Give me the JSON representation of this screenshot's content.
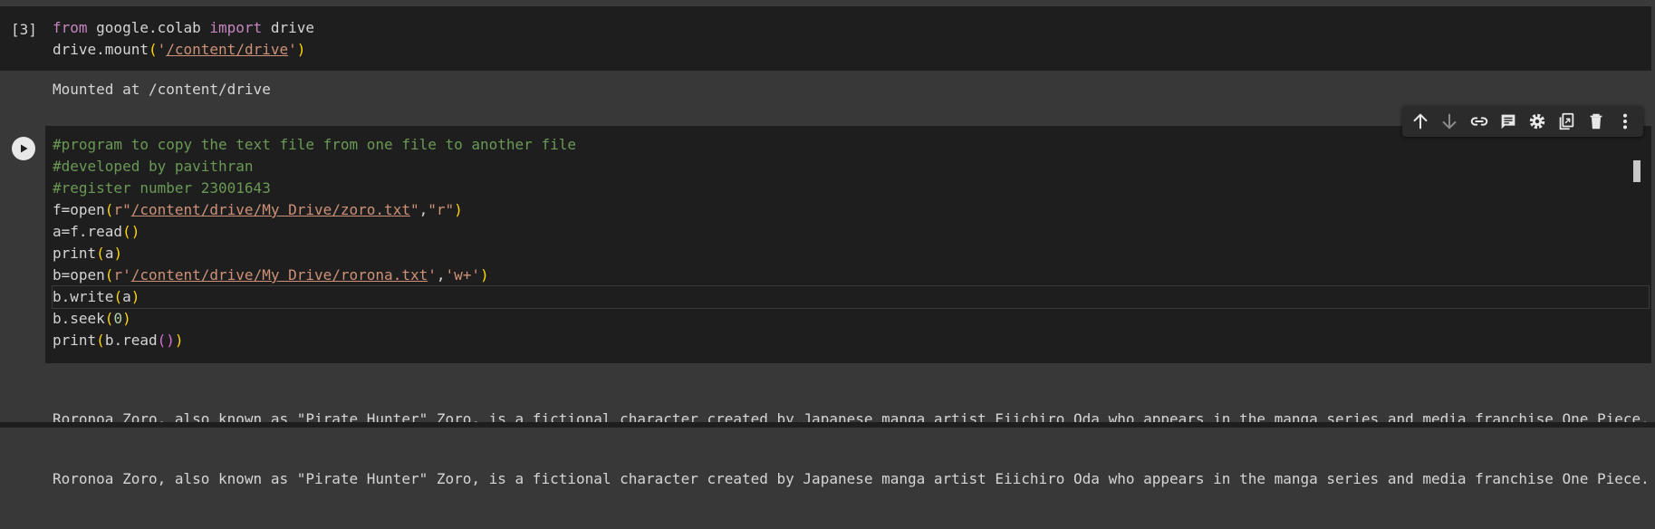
{
  "cell1": {
    "execution_count": "[3]",
    "code_lines": [
      [
        {
          "t": "from",
          "c": "kw"
        },
        {
          "t": " google.colab ",
          "c": "id"
        },
        {
          "t": "import",
          "c": "kw"
        },
        {
          "t": " drive",
          "c": "id"
        }
      ],
      [
        {
          "t": "drive.mount",
          "c": "id"
        },
        {
          "t": "(",
          "c": "paren"
        },
        {
          "t": "'",
          "c": "str"
        },
        {
          "t": "/content/drive",
          "c": "str-u"
        },
        {
          "t": "'",
          "c": "str"
        },
        {
          "t": ")",
          "c": "paren"
        }
      ]
    ],
    "output": "Mounted at /content/drive"
  },
  "toolbar": {
    "items": [
      {
        "name": "move-up-icon",
        "label": "Move cell up"
      },
      {
        "name": "move-down-icon",
        "label": "Move cell down"
      },
      {
        "name": "link-icon",
        "label": "Copy link to cell"
      },
      {
        "name": "comment-icon",
        "label": "Add comment"
      },
      {
        "name": "settings-icon",
        "label": "Open editor settings"
      },
      {
        "name": "mirror-cell-icon",
        "label": "Mirror cell in tab"
      },
      {
        "name": "delete-icon",
        "label": "Delete cell"
      },
      {
        "name": "more-vert-icon",
        "label": "More cell actions"
      }
    ]
  },
  "cell2": {
    "code_lines": [
      [
        {
          "t": "#program to copy the text file from one file to another file",
          "c": "comment"
        }
      ],
      [
        {
          "t": "#developed by pavithran",
          "c": "comment"
        }
      ],
      [
        {
          "t": "#register number 23001643",
          "c": "comment"
        }
      ],
      [
        {
          "t": "f=open",
          "c": "id"
        },
        {
          "t": "(",
          "c": "paren"
        },
        {
          "t": "r\"",
          "c": "str"
        },
        {
          "t": "/content/drive/My Drive/zoro.txt",
          "c": "str-u"
        },
        {
          "t": "\"",
          "c": "str"
        },
        {
          "t": ",",
          "c": "id"
        },
        {
          "t": "\"r\"",
          "c": "str"
        },
        {
          "t": ")",
          "c": "paren"
        }
      ],
      [
        {
          "t": "a=f.read",
          "c": "id"
        },
        {
          "t": "()",
          "c": "paren"
        }
      ],
      [
        {
          "t": "print",
          "c": "id"
        },
        {
          "t": "(",
          "c": "paren"
        },
        {
          "t": "a",
          "c": "id"
        },
        {
          "t": ")",
          "c": "paren"
        }
      ],
      [
        {
          "t": "b=open",
          "c": "id"
        },
        {
          "t": "(",
          "c": "paren"
        },
        {
          "t": "r'",
          "c": "str"
        },
        {
          "t": "/content/drive/My Drive/rorona.txt",
          "c": "str-u"
        },
        {
          "t": "'",
          "c": "str"
        },
        {
          "t": ",",
          "c": "id"
        },
        {
          "t": "'w+'",
          "c": "str"
        },
        {
          "t": ")",
          "c": "paren"
        }
      ],
      [
        {
          "t": "b.write",
          "c": "id"
        },
        {
          "t": "(",
          "c": "paren"
        },
        {
          "t": "a",
          "c": "id"
        },
        {
          "t": ")",
          "c": "paren"
        }
      ],
      [
        {
          "t": "b.seek",
          "c": "id"
        },
        {
          "t": "(",
          "c": "paren"
        },
        {
          "t": "0",
          "c": "num"
        },
        {
          "t": ")",
          "c": "paren"
        }
      ],
      [
        {
          "t": "print",
          "c": "id"
        },
        {
          "t": "(",
          "c": "paren"
        },
        {
          "t": "b.read",
          "c": "id"
        },
        {
          "t": "()",
          "c": "paren2"
        },
        {
          "t": ")",
          "c": "paren"
        }
      ]
    ],
    "active_line": 7,
    "output_lines": [
      "Roronoa Zoro, also known as \"Pirate Hunter\" Zoro, is a fictional character created by Japanese manga artist Eiichiro Oda who appears in the manga series and media franchise One Piece.",
      "Roronoa Zoro, also known as \"Pirate Hunter\" Zoro, is a fictional character created by Japanese manga artist Eiichiro Oda who appears in the manga series and media franchise One Piece."
    ]
  },
  "colors": {
    "editor_bg": "#1e1e1e",
    "output_bg": "#383838",
    "comment": "#6a9955",
    "keyword": "#c586c0",
    "string": "#ce9178",
    "bracket": "#ffd700"
  }
}
